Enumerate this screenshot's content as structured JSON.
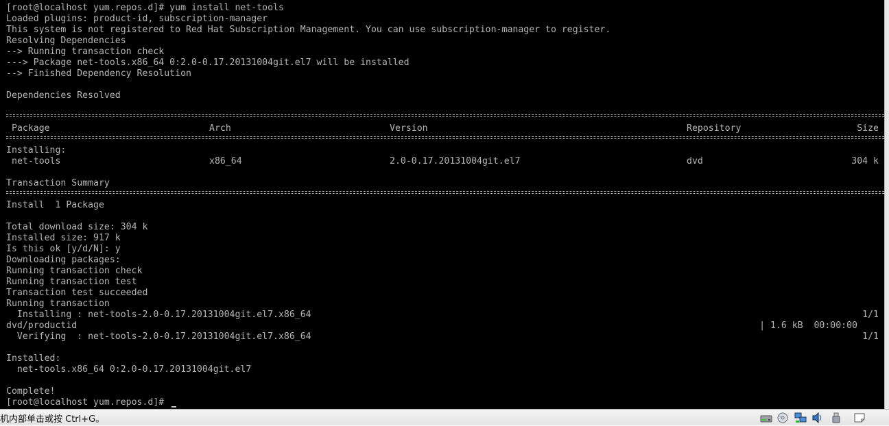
{
  "terminal": {
    "background": "#000000",
    "foreground": "#b4b4b4",
    "lines_top": [
      "[root@localhost yum.repos.d]# yum install net-tools",
      "Loaded plugins: product-id, subscription-manager",
      "This system is not registered to Red Hat Subscription Management. You can use subscription-manager to register.",
      "Resolving Dependencies",
      "--> Running transaction check",
      "---> Package net-tools.x86_64 0:2.0-0.17.20131004git.el7 will be installed",
      "--> Finished Dependency Resolution",
      "",
      "Dependencies Resolved"
    ],
    "table": {
      "headers": {
        "package": "Package",
        "arch": "Arch",
        "version": "Version",
        "repository": "Repository",
        "size": "Size"
      },
      "section_label": "Installing:",
      "row": {
        "package": "net-tools",
        "arch": "x86_64",
        "version": "2.0-0.17.20131004git.el7",
        "repository": "dvd",
        "size": "304 k"
      },
      "summary_label": "Transaction Summary",
      "install_line": "Install  1 Package"
    },
    "lines_bottom": [
      "Total download size: 304 k",
      "Installed size: 917 k",
      "Is this ok [y/d/N]: y",
      "Downloading packages:",
      "Running transaction check",
      "Running transaction test",
      "Transaction test succeeded",
      "Running transaction"
    ],
    "progress": [
      {
        "left": "  Installing : net-tools-2.0-0.17.20131004git.el7.x86_64",
        "right": "1/1"
      },
      {
        "left": "dvd/productid",
        "mid": "| 1.6 kB  00:00:00",
        "right": ""
      },
      {
        "left": "  Verifying  : net-tools-2.0-0.17.20131004git.el7.x86_64",
        "right": "1/1"
      }
    ],
    "lines_end": [
      "",
      "Installed:",
      "  net-tools.x86_64 0:2.0-0.17.20131004git.el7",
      "",
      "Complete!",
      "[root@localhost yum.repos.d]# "
    ]
  },
  "statusbar": {
    "hint_text": "机内部单击或按 Ctrl+G。",
    "icons": [
      "hard-disk-icon",
      "cd-drive-icon",
      "network-adapter-icon",
      "sound-icon",
      "usb-icon",
      "message-log-icon"
    ]
  }
}
